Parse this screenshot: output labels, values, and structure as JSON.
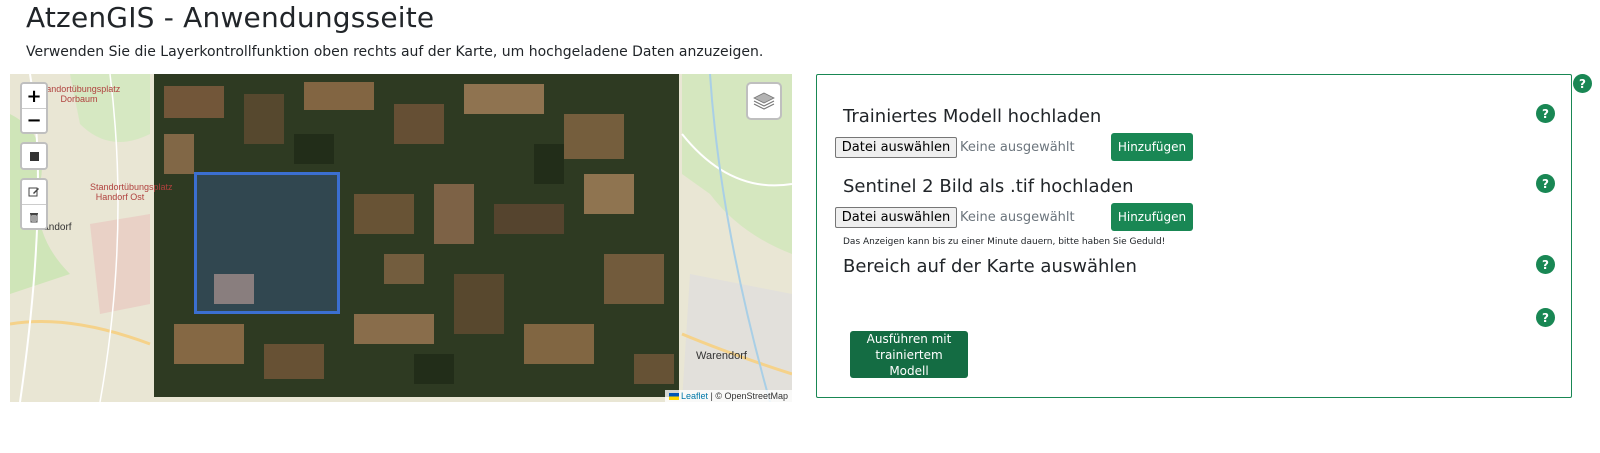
{
  "page": {
    "title": "AtzenGIS - Anwendungsseite",
    "subtitle": "Verwenden Sie die Layerkontrollfunktion oben rechts auf der Karte, um hochgeladene Daten anzuzeigen."
  },
  "map": {
    "zoom_in": "+",
    "zoom_out": "−",
    "draw_rectangle_icon": "square-icon",
    "edit_icon": "edit-icon",
    "delete_icon": "trash-icon",
    "layers_icon": "layers-icon",
    "attribution": {
      "leaflet": "Leaflet",
      "separator": " | © OpenStreetMap"
    },
    "labels": {
      "military1": "Standortübungsplatz Dorbaum",
      "military2": "Standortübungsplatz Handorf Ost",
      "handorf": "Handorf",
      "warendorf": "Warendorf"
    },
    "colors": {
      "osm_base": "#e6e3d3",
      "selection": "#3b6fd1"
    }
  },
  "panel": {
    "model_upload": {
      "heading": "Trainiertes Modell hochladen",
      "file_button": "Datei auswählen",
      "file_status": "Keine ausgewählt",
      "add_button": "Hinzufügen"
    },
    "sentinel_upload": {
      "heading": "Sentinel 2 Bild als .tif hochladen",
      "file_button": "Datei auswählen",
      "file_status": "Keine ausgewählt",
      "add_button": "Hinzufügen",
      "hint": "Das Anzeigen kann bis zu einer Minute dauern, bitte haben Sie Geduld!"
    },
    "area_select": {
      "heading": "Bereich auf der Karte auswählen"
    },
    "run_button": "Ausführen mit trainiertem Modell",
    "help_symbol": "?",
    "colors": {
      "accent": "#198754",
      "run_button": "#146c43"
    }
  }
}
